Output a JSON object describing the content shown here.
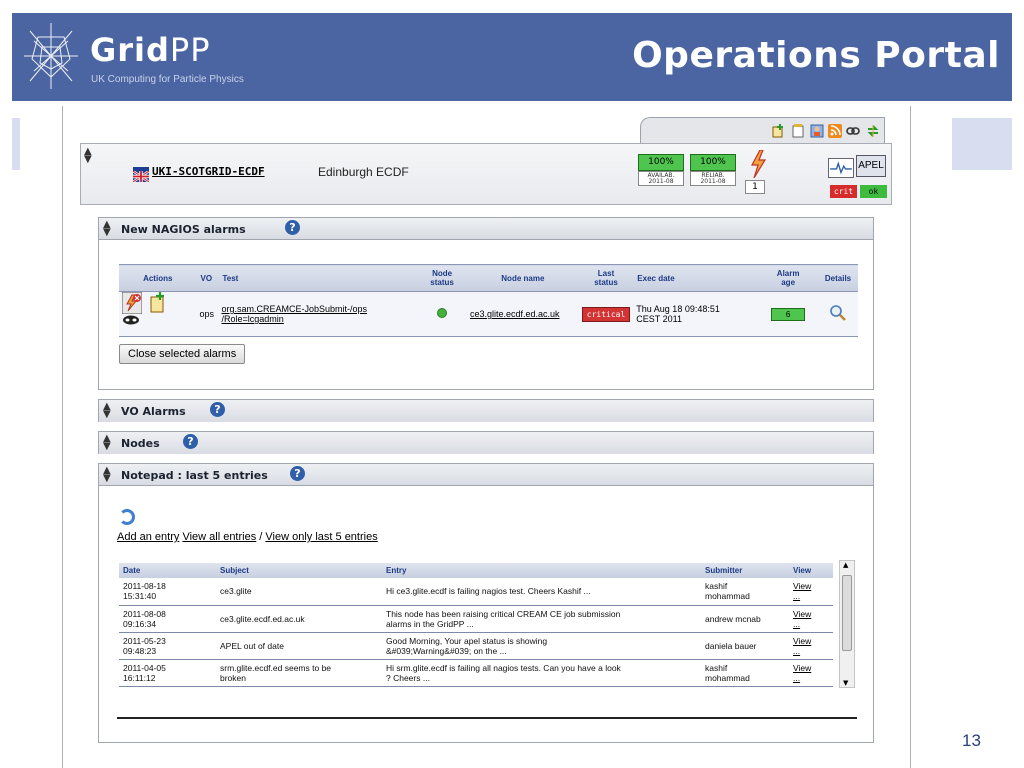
{
  "slide": {
    "logo_name_bold": "Grid",
    "logo_name_light": "PP",
    "logo_subtitle": "UK Computing for Particle Physics",
    "title": "Operations Portal",
    "page_number": "13"
  },
  "toolbar": {
    "icons": [
      "new-ticket-icon",
      "notepad-icon",
      "user-icon",
      "rss-icon",
      "link-icon",
      "refresh-arrows-icon"
    ]
  },
  "site": {
    "flag": "uk-flag-icon",
    "name": "UKI-SCOTGRID-ECDF",
    "description": "Edinburgh ECDF",
    "availability": {
      "value": "100%",
      "label_line1": "AVAILAB.",
      "label_line2": "2011-08"
    },
    "reliability": {
      "value": "100%",
      "label_line1": "RELIAB.",
      "label_line2": "2011-08"
    },
    "alarm_count": "1",
    "apel_label": "APEL",
    "crit_label": "crit",
    "ok_label": "ok"
  },
  "nagios_panel": {
    "title": "New NAGIOS alarms",
    "columns": [
      "Actions",
      "VO",
      "Test",
      "Node status",
      "Node name",
      "Last status",
      "Exec date",
      "Alarm age",
      "Details"
    ],
    "column_labels": {
      "actions": "Actions",
      "vo": "VO",
      "test": "Test",
      "node_status_1": "Node",
      "node_status_2": "status",
      "node_name": "Node name",
      "last_status_1": "Last",
      "last_status_2": "status",
      "exec_date": "Exec date",
      "alarm_age_1": "Alarm",
      "alarm_age_2": "age",
      "details": "Details"
    },
    "row": {
      "vo": "ops",
      "test_line1": "org.sam.CREAMCE-JobSubmit-/ops",
      "test_line2": "/Role=lcgadmin",
      "node_name": "ce3.glite.ecdf.ed.ac.uk",
      "last_status": "critical",
      "exec_date_line1": "Thu Aug 18 09:48:51",
      "exec_date_line2": "CEST 2011",
      "alarm_age": "6"
    },
    "close_button": "Close selected alarms"
  },
  "vo_panel": {
    "title": "VO Alarms"
  },
  "nodes_panel": {
    "title": "Nodes"
  },
  "notepad_panel": {
    "title": "Notepad : last 5 entries",
    "add_entry": "Add an entry",
    "view_all": "View all entries",
    "separator": "/",
    "view_last5": "View only last 5 entries",
    "columns": {
      "date": "Date",
      "subject": "Subject",
      "entry": "Entry",
      "submitter": "Submitter",
      "view": "View"
    },
    "rows": [
      {
        "date1": "2011-08-18",
        "date2": "15:31:40",
        "subject1": "ce3.glite",
        "subject2": "",
        "entry1": "Hi ce3.glite.ecdf is failing nagios test. Cheers Kashif ...",
        "entry2": "",
        "submitter1": "kashif",
        "submitter2": "mohammad",
        "view1": "View",
        "view2": "..."
      },
      {
        "date1": "2011-08-08",
        "date2": "09:16:34",
        "subject1": "ce3.glite.ecdf.ed.ac.uk",
        "subject2": "",
        "entry1": "This node has been raising critical CREAM CE job submission",
        "entry2": "alarms in the GridPP ...",
        "submitter1": "andrew mcnab",
        "submitter2": "",
        "view1": "View",
        "view2": "..."
      },
      {
        "date1": "2011-05-23",
        "date2": "09:48:23",
        "subject1": "APEL out of date",
        "subject2": "",
        "entry1": "Good Morning, Your apel status is showing",
        "entry2": "&#039;Warning&#039; on the ...",
        "submitter1": "daniela bauer",
        "submitter2": "",
        "view1": "View",
        "view2": "..."
      },
      {
        "date1": "2011-04-05",
        "date2": "16:11:12",
        "subject1": "srm.glite.ecdf.ed seems to be",
        "subject2": "broken",
        "entry1": "Hi srm.glite.ecdf is failing all nagios tests. Can you have a look",
        "entry2": "? Cheers ...",
        "submitter1": "kashif",
        "submitter2": "mohammad",
        "view1": "View",
        "view2": "..."
      }
    ]
  },
  "colors": {
    "header_bg": "#4b65a2",
    "status_green": "#4fc44f",
    "critical_red": "#d33333",
    "table_header_text": "#1d3a86"
  }
}
